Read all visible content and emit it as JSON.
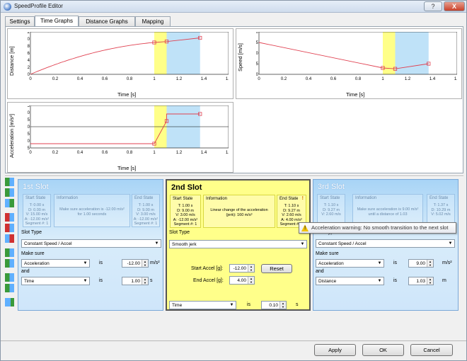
{
  "window": {
    "title": "SpeedProfile Editor",
    "help_label": "?",
    "close_label": "X"
  },
  "tabs": [
    {
      "label": "Settings"
    },
    {
      "label": "Time Graphs",
      "active": true
    },
    {
      "label": "Distance Graphs"
    },
    {
      "label": "Mapping"
    }
  ],
  "graphs": {
    "distance": {
      "ylabel": "Distance [m]",
      "xlabel": "Time [s]",
      "xticks": [
        "0",
        "0.2",
        "0.4",
        "0.6",
        "0.8",
        "1",
        "1.2",
        "1.4",
        "1.6"
      ],
      "yticks": [
        "12",
        "10",
        "8",
        "6",
        "4",
        "2",
        "0"
      ]
    },
    "speed": {
      "ylabel": "Speed [m/s]",
      "xlabel": "Time [s]",
      "xticks": [
        "0",
        "0.2",
        "0.4",
        "0.6",
        "0.8",
        "1",
        "1.2",
        "1.4",
        "1.6"
      ],
      "yticks": [
        "20",
        "15",
        "10",
        "5",
        "0"
      ]
    },
    "accel": {
      "ylabel": "Acceleration [m/s²]",
      "xlabel": "Time [s]",
      "xticks": [
        "0",
        "0.2",
        "0.4",
        "0.6",
        "0.8",
        "1",
        "1.2",
        "1.4",
        "1.6"
      ],
      "yticks": [
        "15",
        "10",
        "5",
        "0",
        "-5",
        "-10",
        "-15"
      ]
    }
  },
  "chart_data": [
    {
      "type": "line",
      "ylabel": "Distance [m]",
      "xlabel": "Time [s]",
      "xlim": [
        0,
        1.6
      ],
      "ylim": [
        0,
        12
      ],
      "x": [
        0,
        0.2,
        0.4,
        0.6,
        0.8,
        1.0,
        1.1,
        1.37
      ],
      "y": [
        0,
        3.6,
        6.2,
        7.8,
        8.7,
        9.0,
        9.27,
        10.3
      ]
    },
    {
      "type": "line",
      "ylabel": "Speed [m/s]",
      "xlabel": "Time [s]",
      "xlim": [
        0,
        1.6
      ],
      "ylim": [
        0,
        20
      ],
      "x": [
        0,
        1.0,
        1.1,
        1.37
      ],
      "y": [
        15,
        3.0,
        2.6,
        5.0
      ]
    },
    {
      "type": "line",
      "ylabel": "Acceleration [m/s²]",
      "xlabel": "Time [s]",
      "xlim": [
        0,
        1.6
      ],
      "ylim": [
        -15,
        15
      ],
      "x": [
        0,
        1.0,
        1.1,
        1.1,
        1.37
      ],
      "y": [
        -12,
        -12,
        4,
        9,
        9
      ]
    }
  ],
  "slots": [
    {
      "title": "1st Slot",
      "start": {
        "label": "Start State",
        "lines": [
          "T: 0.00 s",
          "D: 0.00 m",
          "V: 15.00 m/s",
          "A: -12.00 m/s²",
          "Segment #: 1"
        ]
      },
      "info": {
        "label": "Information",
        "text": "Make sure acceleration is -12.00 m/s² for 1.00 seconds"
      },
      "end": {
        "label": "End State",
        "lines": [
          "T: 1.00 s",
          "D: 9.00 m",
          "V: 3.00 m/s",
          "A: -12.00 m/s²",
          "Segment #: 1"
        ]
      },
      "slot_type_label": "Slot Type",
      "slot_type": "Constant Speed / Accel",
      "make_sure_label": "Make sure",
      "param1": "Acceleration",
      "is1": "is",
      "value1": "-12.00",
      "unit1": "m/s²",
      "and_label": "and",
      "param2": "Time",
      "is2": "is",
      "value2": "1.00",
      "unit2": "s"
    },
    {
      "title": "2nd Slot",
      "start": {
        "label": "Start State",
        "lines": [
          "T: 1.00 s",
          "D: 9.00 m",
          "V: 3.00 m/s",
          "A: -12.00 m/s²",
          "Segment #: 1"
        ]
      },
      "info": {
        "label": "Information",
        "text": "Linear change of the acceleration (jerk): 160 m/s³"
      },
      "end": {
        "label": "End State",
        "warn": "!",
        "lines": [
          "T: 1.10 s",
          "D: 9.27 m",
          "V: 2.60 m/s",
          "A: 4.00 m/s²",
          "Segment #: 1"
        ]
      },
      "slot_type_label": "Slot Type",
      "slot_type": "Smooth jerk",
      "start_accel_label": "Start Accel [g]:",
      "start_accel": "-12.00",
      "end_accel_label": "End Accel [g]:",
      "end_accel": "4.00",
      "reset_label": "Reset",
      "param": "Time",
      "is": "is",
      "value": "0.10",
      "unit": "s"
    },
    {
      "title": "3rd Slot",
      "start": {
        "label": "Start State",
        "lines": [
          "T: 1.10 s",
          "D: 9.27 m",
          "V: 2.60 m/s"
        ]
      },
      "info": {
        "label": "Information",
        "text": "Make sure acceleration is 9.00 m/s² until a distance of 1.03"
      },
      "end": {
        "label": "End State",
        "lines": [
          "T: 1.37 s",
          "D: 10.29 m",
          "V: 5.02 m/s"
        ]
      },
      "slot_type_label": "Slot Type",
      "slot_type": "Constant Speed / Accel",
      "make_sure_label": "Make sure",
      "param1": "Acceleration",
      "is1": "is",
      "value1": "9.00",
      "unit1": "m/s²",
      "and_label": "and",
      "param2": "Distance",
      "is2": "is",
      "value2": "1.03",
      "unit2": "m"
    }
  ],
  "tooltip": "Acceleration warning: No smooth transition to the next slot",
  "buttons": {
    "apply": "Apply",
    "ok": "OK",
    "cancel": "Cancel"
  },
  "colors": {
    "slot_band": "#ffff88",
    "range_band": "#bfe2f8",
    "curve": "#e04050"
  }
}
